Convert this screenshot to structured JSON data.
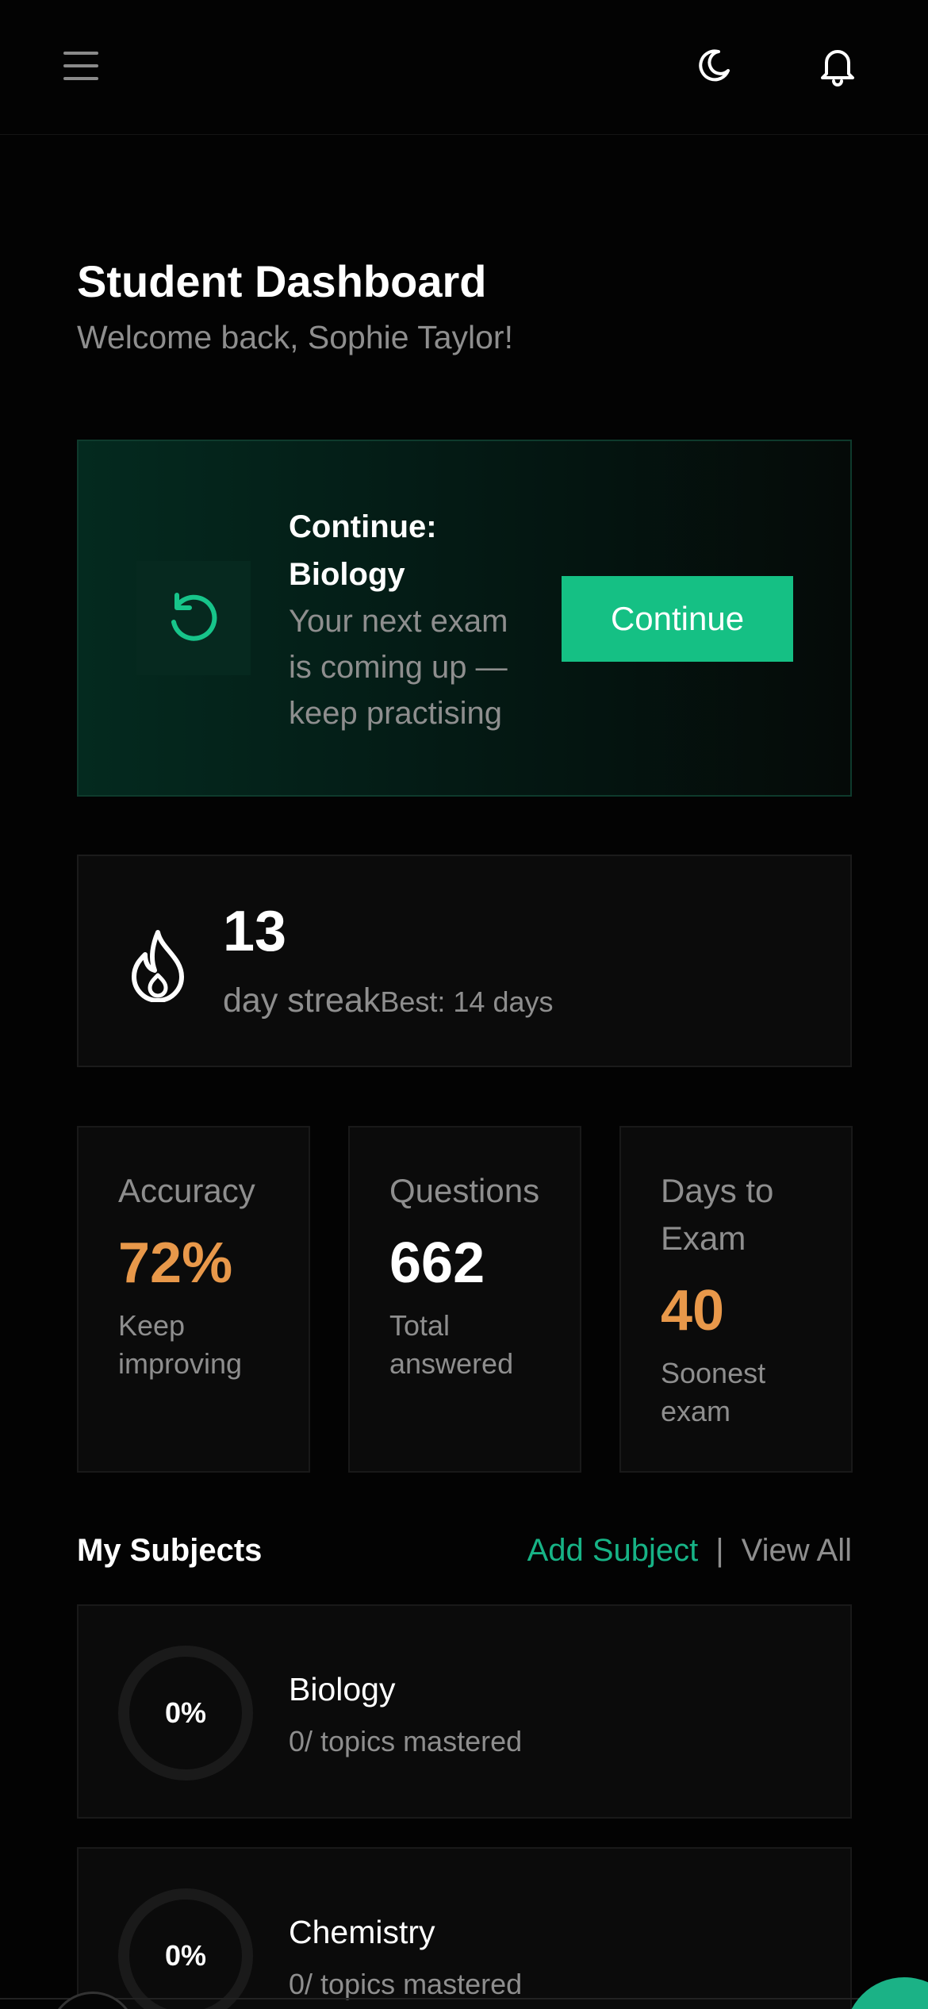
{
  "header": {
    "icons": {
      "menu": "menu-icon",
      "theme": "moon-icon",
      "notifications": "bell-icon"
    }
  },
  "page": {
    "title": "Student Dashboard",
    "welcome": "Welcome back, Sophie Taylor!"
  },
  "continue_card": {
    "title": "Continue: Biology",
    "subtitle": "Your next exam is coming up — keep practising",
    "button_label": "Continue",
    "icon": "restart-icon",
    "accent": "#15c084"
  },
  "streak": {
    "number": "13",
    "label": "day streak",
    "best": "Best: 14 days",
    "icon": "flame-icon"
  },
  "stats": [
    {
      "label": "Accuracy",
      "value": "72%",
      "note": "Keep improving",
      "color": "#e8984a"
    },
    {
      "label": "Questions",
      "value": "662",
      "note": "Total answered",
      "color": "#ffffff"
    },
    {
      "label": "Days to Exam",
      "value": "40",
      "note": "Soonest exam",
      "color": "#e8984a"
    }
  ],
  "subjects_section": {
    "title": "My Subjects",
    "add_label": "Add Subject",
    "separator": "|",
    "view_all_label": "View All"
  },
  "subjects": [
    {
      "name": "Biology",
      "progress": "0%",
      "mastered": "0/ topics mastered"
    },
    {
      "name": "Chemistry",
      "progress": "0%",
      "mastered": "0/ topics mastered"
    }
  ]
}
